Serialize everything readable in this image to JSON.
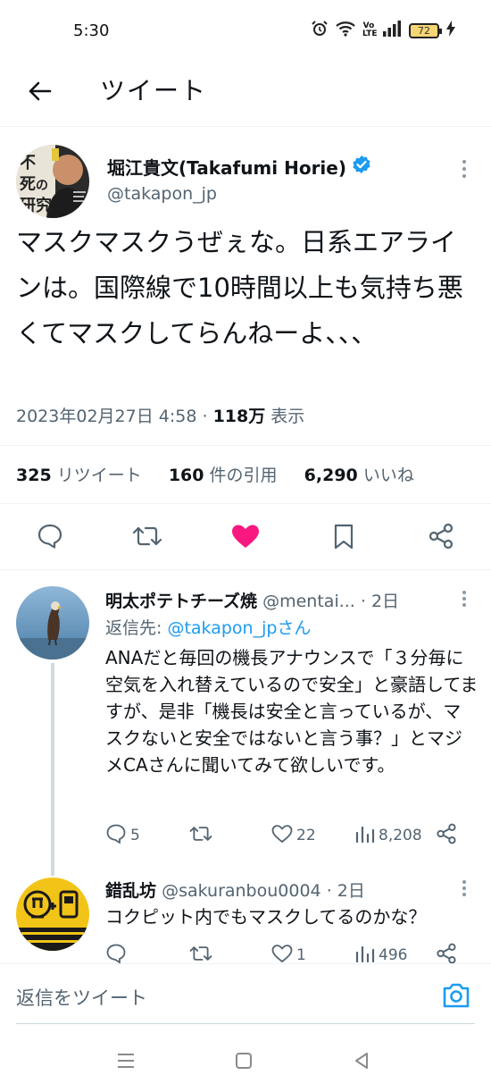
{
  "status_bar": {
    "time": "5:30",
    "battery": "72",
    "volte": "Vo LTE"
  },
  "header": {
    "title": "ツイート"
  },
  "tweet": {
    "author_name": "堀江貴文(Takafumi Horie)",
    "handle": "@takapon_jp",
    "text": "マスクマスクうぜぇな。日系エアラインは。国際線で10時間以上も気持ち悪くてマスクしてらんねーよ、、、",
    "timestamp": "2023年02月27日 4:58",
    "views_count": "118万",
    "views_label": "表示",
    "retweets_count": "325",
    "retweets_label": "リツイート",
    "quotes_count": "160",
    "quotes_label": "件の引用",
    "likes_count": "6,290",
    "likes_label": "いいね",
    "liked": true,
    "avatar_text": "不死の研究"
  },
  "replies": [
    {
      "name": "明太ポテトチーズ焼",
      "handle": "@mentai...",
      "time": "· 2日",
      "reply_to_label": "返信先:",
      "reply_to_handle": "@takapon_jpさん",
      "text": "ANAだと毎回の機長アナウンスで「３分毎に空気を入れ替えているので安全」と豪語してますが、是非「機長は安全と言っているが、マスクないと安全ではないと言う事？」とマジメCAさんに聞いてみて欲しいです。",
      "replies_count": "5",
      "retweets_count": "",
      "likes_count": "22",
      "views_count": "8,208"
    },
    {
      "name": "錯乱坊",
      "handle": "@sakuranbou0004",
      "time": "· 2日",
      "text": "コクピット内でもマスクしてるのかな？",
      "replies_count": "",
      "retweets_count": "",
      "likes_count": "1",
      "views_count": "496"
    }
  ],
  "compose": {
    "placeholder": "返信をツイート"
  },
  "colors": {
    "accent": "#1d9bf0",
    "like": "#f91880",
    "secondary_text": "#536471"
  }
}
